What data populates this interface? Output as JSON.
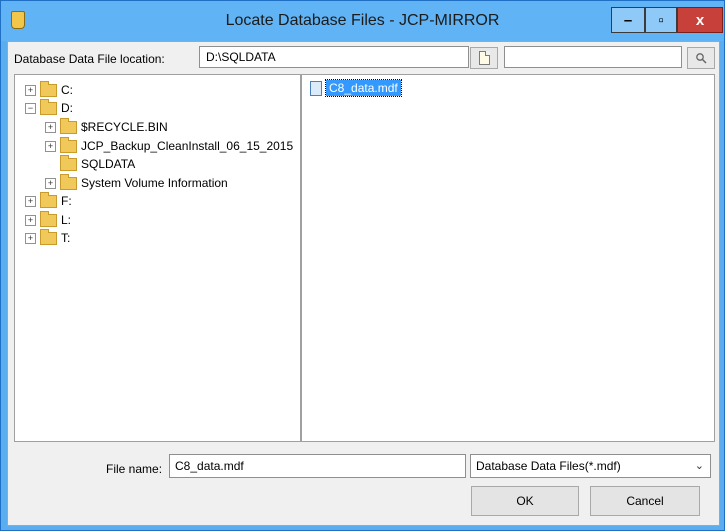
{
  "window": {
    "title": "Locate Database Files - JCP-MIRROR",
    "minimize_glyph": "–",
    "maximize_glyph": "▫",
    "close_glyph": "x"
  },
  "location": {
    "label": "Database Data File location:",
    "value": "D:\\SQLDATA",
    "search_value": ""
  },
  "tree": {
    "nodes": [
      {
        "label": "C:",
        "expander": "+"
      },
      {
        "label": "D:",
        "expander": "−"
      },
      {
        "label": "$RECYCLE.BIN",
        "expander": "+"
      },
      {
        "label": "JCP_Backup_CleanInstall_06_15_2015",
        "expander": "+"
      },
      {
        "label": "SQLDATA",
        "expander": ""
      },
      {
        "label": "System Volume Information",
        "expander": "+"
      },
      {
        "label": "F:",
        "expander": "+"
      },
      {
        "label": "L:",
        "expander": "+"
      },
      {
        "label": "T:",
        "expander": "+"
      }
    ]
  },
  "files": [
    {
      "name": "C8_data.mdf",
      "selected": true
    }
  ],
  "filename": {
    "label": "File name:",
    "value": "C8_data.mdf"
  },
  "filter": {
    "selected": "Database Data Files(*.mdf)",
    "caret": "⌄"
  },
  "buttons": {
    "ok": "OK",
    "cancel": "Cancel"
  },
  "colors": {
    "titlebar": "#60b3f4",
    "close": "#c7403a",
    "selection": "#3399ff"
  },
  "icons": {
    "browse": "document-icon",
    "search": "magnifier-icon"
  }
}
